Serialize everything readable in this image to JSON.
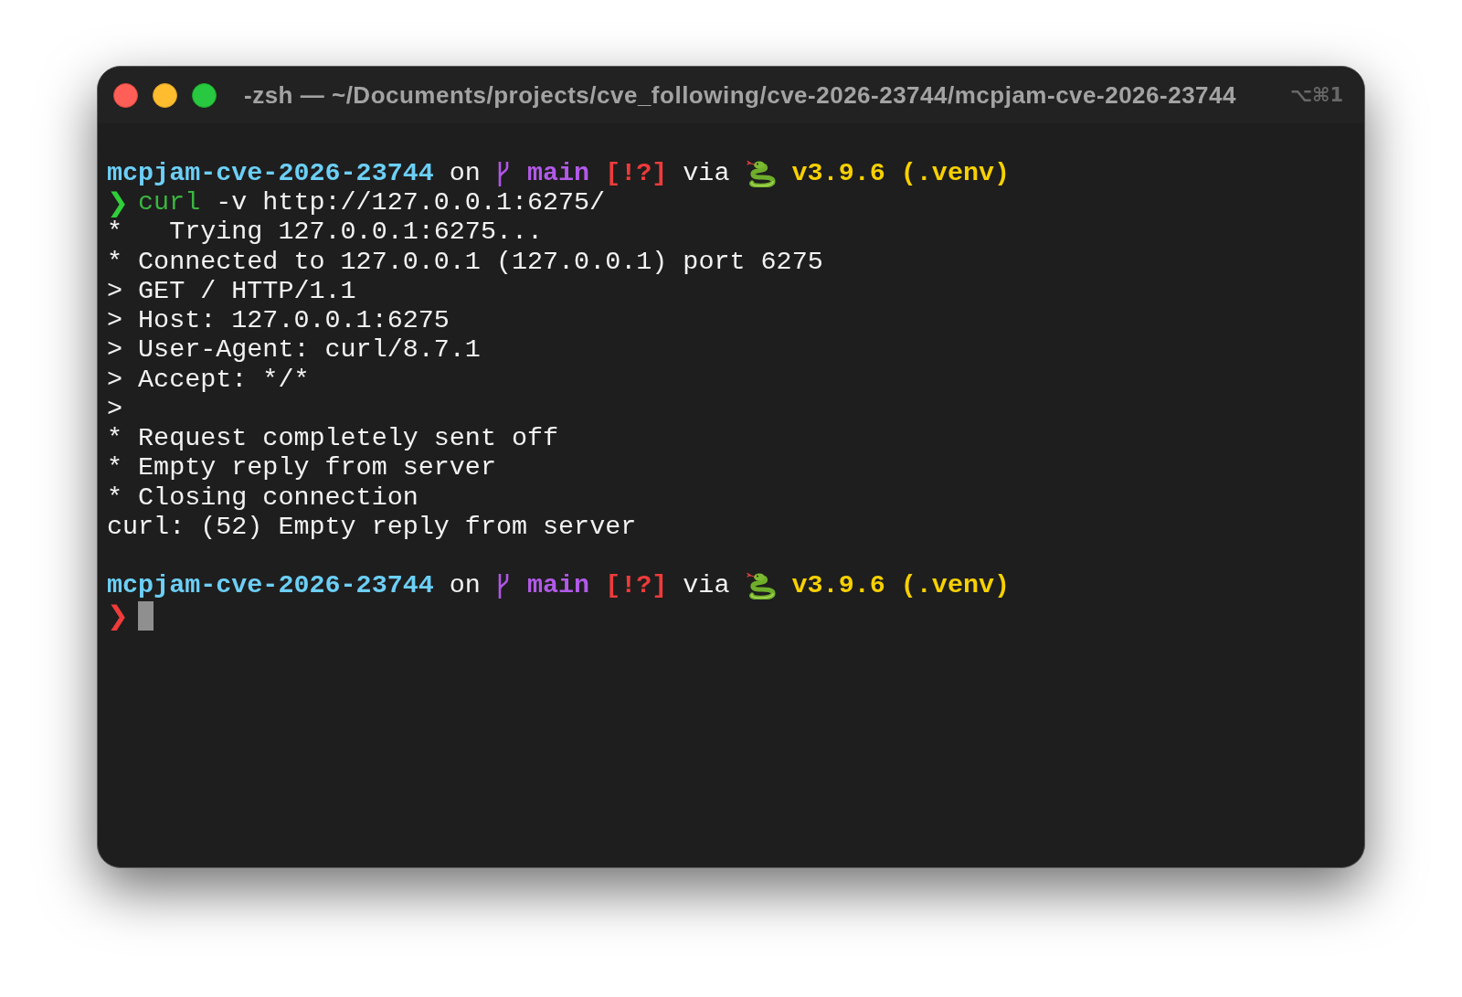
{
  "window": {
    "title": "-zsh — ~/Documents/projects/cve_following/cve-2026-23744/mcpjam-cve-2026-23744",
    "shortcut": "⌥⌘1"
  },
  "terminal": {
    "lines": [
      {
        "kind": "prompt",
        "directory": "mcpjam-cve-2026-23744",
        "on": "on",
        "branch": "main",
        "git_status": "[!?]",
        "via": "via",
        "python_version": "v3.9.6 (.venv)"
      },
      {
        "kind": "command",
        "symbol": "❯",
        "error": false,
        "command": "curl",
        "args": "-v http://127.0.0.1:6275/"
      },
      {
        "kind": "output",
        "text": "*   Trying 127.0.0.1:6275..."
      },
      {
        "kind": "output",
        "text": "* Connected to 127.0.0.1 (127.0.0.1) port 6275"
      },
      {
        "kind": "output",
        "text": "> GET / HTTP/1.1"
      },
      {
        "kind": "output",
        "text": "> Host: 127.0.0.1:6275"
      },
      {
        "kind": "output",
        "text": "> User-Agent: curl/8.7.1"
      },
      {
        "kind": "output",
        "text": "> Accept: */*"
      },
      {
        "kind": "output",
        "text": ">"
      },
      {
        "kind": "output",
        "text": "* Request completely sent off"
      },
      {
        "kind": "output",
        "text": "* Empty reply from server"
      },
      {
        "kind": "output",
        "text": "* Closing connection"
      },
      {
        "kind": "output",
        "text": "curl: (52) Empty reply from server"
      },
      {
        "kind": "blank"
      },
      {
        "kind": "prompt",
        "directory": "mcpjam-cve-2026-23744",
        "on": "on",
        "branch": "main",
        "git_status": "[!?]",
        "via": "via",
        "python_version": "v3.9.6 (.venv)"
      },
      {
        "kind": "input",
        "symbol": "❯",
        "error": true,
        "cursor": true
      }
    ]
  }
}
